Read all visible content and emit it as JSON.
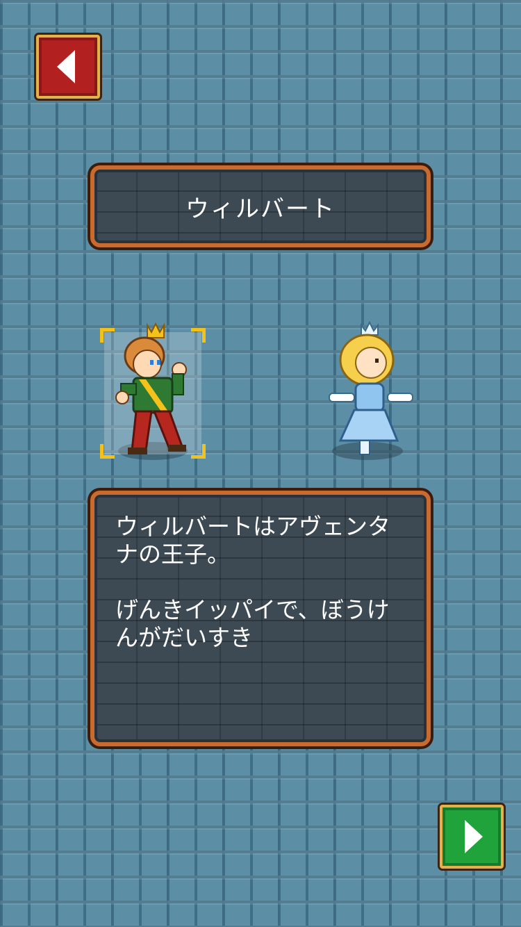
{
  "screen": "character-select",
  "character_name": "ウィルバート",
  "description": "ウィルバートはアヴェンタ\nナの王子。\n\nげんきイッパイで、ぼうけ\nんがだいすき",
  "characters": [
    {
      "id": "wilbert",
      "selected": true
    },
    {
      "id": "princess",
      "selected": false
    }
  ],
  "colors": {
    "back_button": "#b32020",
    "next_button": "#1fa33a",
    "panel_border": "#c96a2e",
    "selection_corner": "#f3c11b"
  },
  "icons": {
    "back": "arrow-left-icon",
    "next": "arrow-right-icon"
  }
}
